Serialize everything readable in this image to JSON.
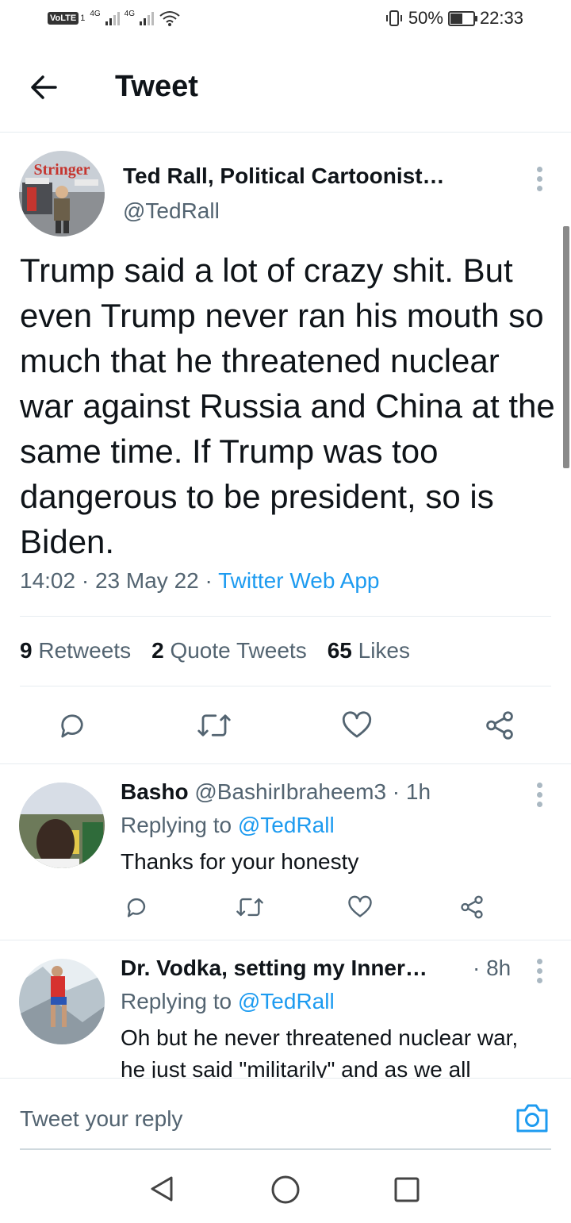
{
  "status_bar": {
    "volte": "VoLTE",
    "sim1": "1",
    "net1": "4G",
    "net2": "4G",
    "battery": "50%",
    "time": "22:33"
  },
  "header": {
    "title": "Tweet"
  },
  "tweet": {
    "author_name": "Ted Rall, Political Cartoonist…",
    "author_handle": "@TedRall",
    "avatar_label": "Stringer",
    "text": "Trump said a lot of crazy shit. But even Trump never ran his mouth so much that he threatened nuclear war against Russia and China at the same time. If Trump was too dangerous to be president, so is Biden.",
    "time": "14:02",
    "date": "23 May 22",
    "separator": "·",
    "source": "Twitter Web App",
    "stats": {
      "retweets_count": "9",
      "retweets_label": "Retweets",
      "quotes_count": "2",
      "quotes_label": "Quote Tweets",
      "likes_count": "65",
      "likes_label": "Likes"
    },
    "actions": [
      "reply-icon",
      "retweet-icon",
      "like-icon",
      "share-icon"
    ]
  },
  "replies": [
    {
      "name": "Basho",
      "handle": "@BashirIbraheem3",
      "age": "· 1h",
      "replying_prefix": "Replying to",
      "replying_to": "@TedRall",
      "text": "Thanks for your honesty"
    },
    {
      "name": "Dr. Vodka, setting my Inner…",
      "age": "· 8h",
      "replying_prefix": "Replying to",
      "replying_to": "@TedRall",
      "text_line1": "Oh but he never threatened nuclear war,",
      "text_line2": "he just said \"militarily\" and as we all"
    }
  ],
  "composer": {
    "placeholder": "Tweet your reply"
  },
  "navbar": {
    "buttons": [
      "back-triangle-icon",
      "home-circle-icon",
      "recents-square-icon"
    ]
  },
  "colors": {
    "accent": "#1d9bf0",
    "secondary_text": "#536471",
    "primary_text": "#0f1419"
  }
}
